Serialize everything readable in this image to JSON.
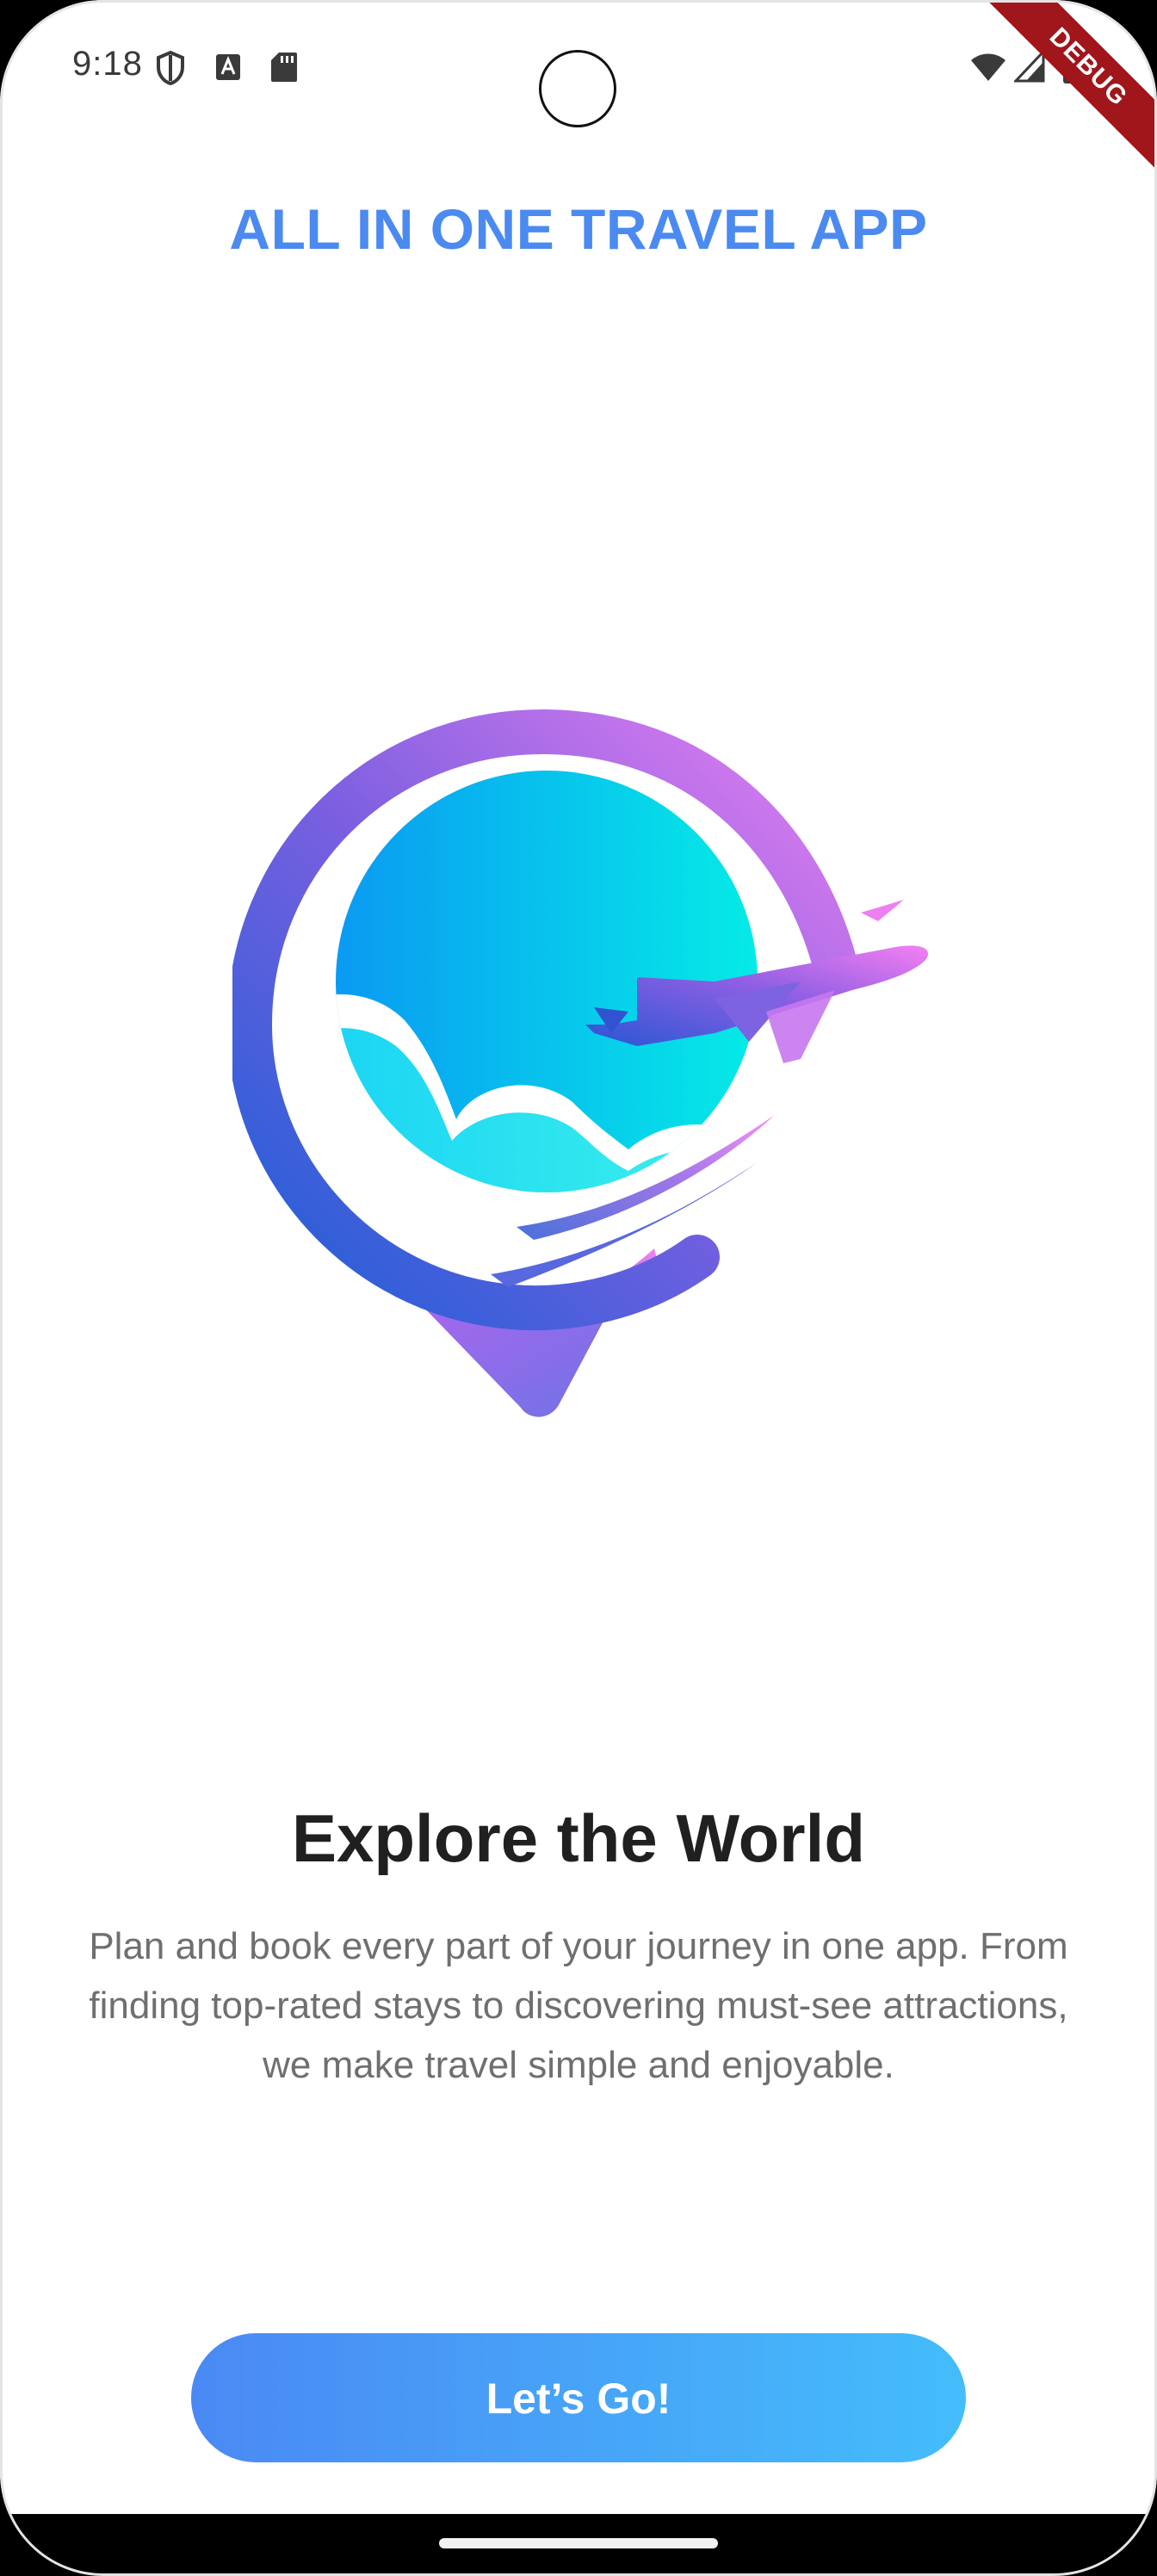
{
  "status_bar": {
    "time": "9:18",
    "left_icons": [
      "shield-icon",
      "font-a-icon",
      "sd-card-icon"
    ],
    "right_icons": [
      "wifi-icon",
      "signal-icon",
      "battery-icon"
    ]
  },
  "debug_banner": {
    "label": "DEBUG",
    "color": "#a0161b"
  },
  "header": {
    "title": "ALL IN ONE TRAVEL APP",
    "color": "#4b8af0"
  },
  "hero": {
    "logo_icon": "travel-airplane-pin-logo-icon"
  },
  "onboarding": {
    "headline": "Explore the World",
    "description": "Plan and book every part of your journey in one app. From finding top-rated stays to discovering must-see attractions, we make travel simple and enjoyable."
  },
  "cta": {
    "label": "Let’s Go!",
    "gradient": [
      "#4a89f4",
      "#44bdfb"
    ]
  },
  "system_nav": {
    "home_indicator": "home-indicator"
  }
}
